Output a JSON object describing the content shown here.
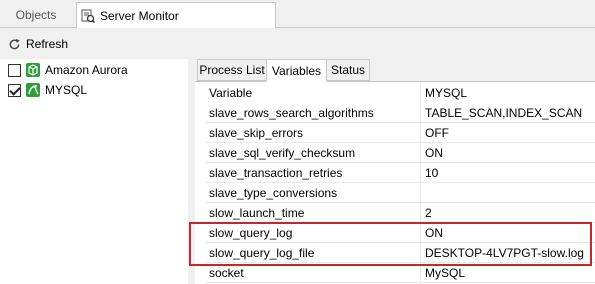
{
  "top_tabs": {
    "objects": "Objects",
    "server_monitor": "Server Monitor"
  },
  "toolbar": {
    "refresh_label": "Refresh"
  },
  "servers": [
    {
      "label": "Amazon Aurora",
      "checked": false,
      "icon": "amazon-aurora-icon",
      "color": "#2e9e3a"
    },
    {
      "label": "MYSQL",
      "checked": true,
      "icon": "mysql-icon",
      "color": "#2e9e3a"
    }
  ],
  "inner_tabs": [
    {
      "label": "Process List",
      "active": false
    },
    {
      "label": "Variables",
      "active": true
    },
    {
      "label": "Status",
      "active": false
    }
  ],
  "grid": {
    "header": {
      "variable": "Variable",
      "value": "MYSQL"
    },
    "rows": [
      {
        "variable": "slave_rows_search_algorithms",
        "value": "TABLE_SCAN,INDEX_SCAN"
      },
      {
        "variable": "slave_skip_errors",
        "value": "OFF"
      },
      {
        "variable": "slave_sql_verify_checksum",
        "value": "ON"
      },
      {
        "variable": "slave_transaction_retries",
        "value": "10"
      },
      {
        "variable": "slave_type_conversions",
        "value": ""
      },
      {
        "variable": "slow_launch_time",
        "value": "2"
      },
      {
        "variable": "slow_query_log",
        "value": "ON"
      },
      {
        "variable": "slow_query_log_file",
        "value": "DESKTOP-4LV7PGT-slow.log"
      },
      {
        "variable": "socket",
        "value": "MySQL"
      }
    ]
  },
  "colors": {
    "highlight": "#c8262c",
    "db_icon": "#2e9e3a"
  }
}
